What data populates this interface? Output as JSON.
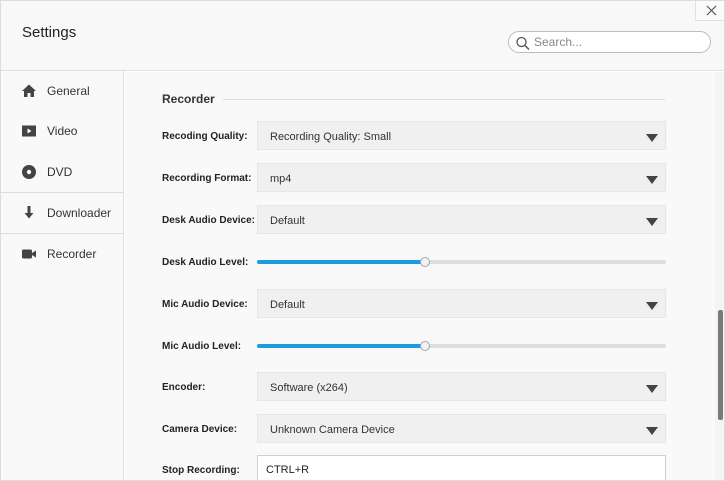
{
  "window": {
    "title": "Settings"
  },
  "search": {
    "placeholder": "Search..."
  },
  "sidebar": {
    "items": [
      {
        "label": "General",
        "icon": "home-icon"
      },
      {
        "label": "Video",
        "icon": "video-icon"
      },
      {
        "label": "DVD",
        "icon": "disc-icon"
      },
      {
        "label": "Downloader",
        "icon": "download-icon"
      },
      {
        "label": "Recorder",
        "icon": "camera-icon"
      }
    ]
  },
  "recorder": {
    "section_title": "Recorder",
    "recording_quality": {
      "label": "Recoding Quality:",
      "value": "Recording Quality: Small"
    },
    "recording_format": {
      "label": "Recording Format:",
      "value": "mp4"
    },
    "desk_audio_device": {
      "label": "Desk Audio Device:",
      "value": "Default"
    },
    "desk_audio_level": {
      "label": "Desk Audio Level:",
      "level": 0.41
    },
    "mic_audio_device": {
      "label": "Mic Audio Device:",
      "value": "Default"
    },
    "mic_audio_level": {
      "label": "Mic Audio Level:",
      "level": 0.41
    },
    "encoder": {
      "label": "Encoder:",
      "value": "Software (x264)"
    },
    "camera_device": {
      "label": "Camera Device:",
      "value": "Unknown Camera Device"
    },
    "stop_recording": {
      "label": "Stop Recording:",
      "value": "CTRL+R"
    }
  },
  "colors": {
    "accent": "#1a9ce0",
    "icon": "#444444"
  }
}
